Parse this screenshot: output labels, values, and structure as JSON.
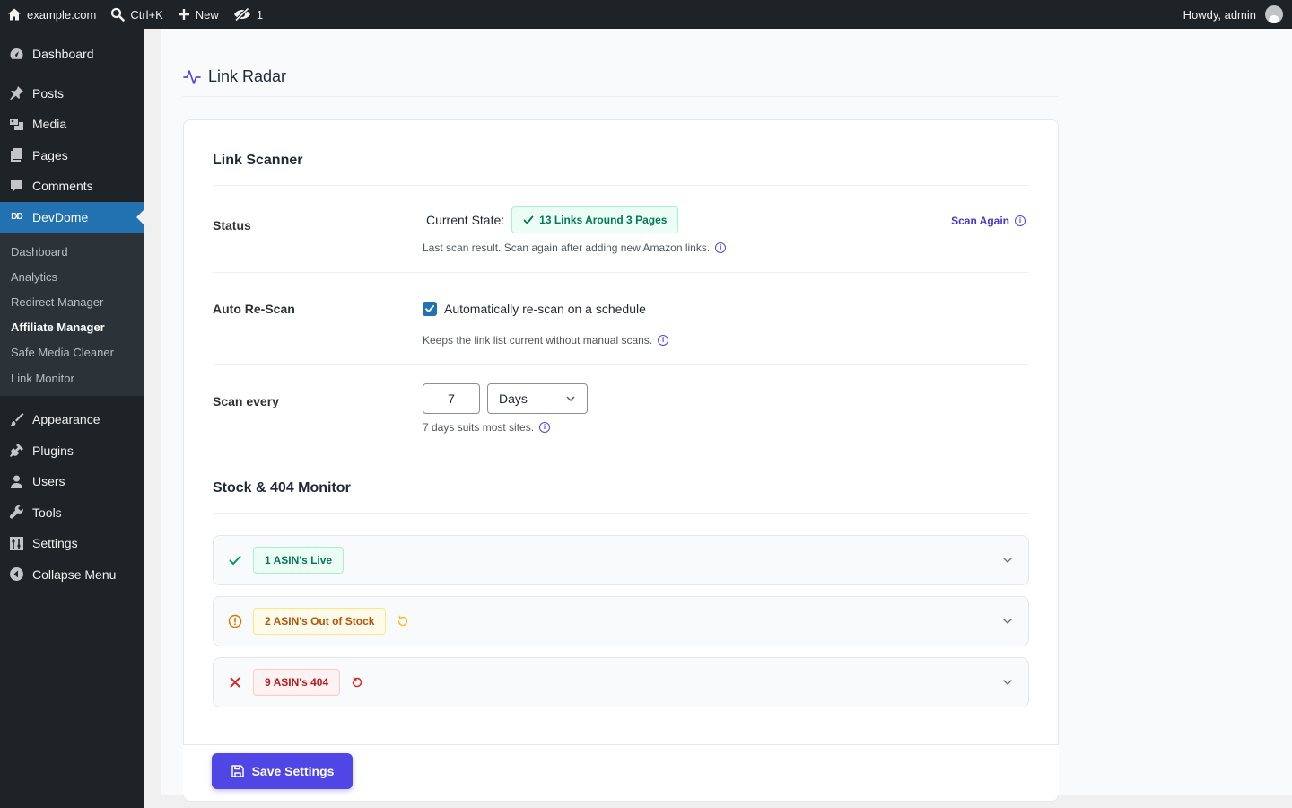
{
  "adminbar": {
    "site": "example.com",
    "search": "Ctrl+K",
    "new": "New",
    "hidden_count": "1",
    "greeting": "Howdy, admin"
  },
  "sidebar": {
    "items_top": [
      {
        "label": "Dashboard",
        "icon": "dashboard-icon"
      },
      {
        "label": "Posts",
        "icon": "pushpin-icon"
      },
      {
        "label": "Media",
        "icon": "media-icon"
      },
      {
        "label": "Pages",
        "icon": "pages-icon"
      },
      {
        "label": "Comments",
        "icon": "comment-icon"
      },
      {
        "label": "DevDome",
        "icon": "devdome-logo-icon",
        "logo_text": "DD"
      }
    ],
    "submenu": [
      {
        "label": "Dashboard"
      },
      {
        "label": "Analytics"
      },
      {
        "label": "Redirect Manager"
      },
      {
        "label": "Affiliate Manager",
        "current": true
      },
      {
        "label": "Safe Media Cleaner"
      },
      {
        "label": "Link Monitor"
      }
    ],
    "items_bottom": [
      {
        "label": "Appearance",
        "icon": "paintbrush-icon"
      },
      {
        "label": "Plugins",
        "icon": "plugin-icon"
      },
      {
        "label": "Users",
        "icon": "user-icon"
      },
      {
        "label": "Tools",
        "icon": "wrench-icon"
      },
      {
        "label": "Settings",
        "icon": "settings-icon"
      },
      {
        "label": "Collapse Menu",
        "icon": "collapse-icon"
      }
    ]
  },
  "page": {
    "title": "Link Radar"
  },
  "scanner": {
    "title": "Link Scanner",
    "status_label": "Status",
    "current_state_label": "Current State:",
    "state_badge": "13 Links Around 3 Pages",
    "status_help": "Last scan result. Scan again after adding new Amazon links.",
    "scan_again": "Scan Again",
    "auto_label": "Auto Re-Scan",
    "auto_checkbox_label": "Automatically re-scan on a schedule",
    "auto_checked": true,
    "auto_help": "Keeps the link list current without manual scans.",
    "every_label": "Scan every",
    "every_value": "7",
    "every_unit": "Days",
    "every_help": "7 days suits most sites."
  },
  "monitor": {
    "title": "Stock & 404 Monitor",
    "rows": [
      {
        "badge": "1 ASIN's Live",
        "status": "live",
        "color": "#047857"
      },
      {
        "badge": "2 ASIN's Out of Stock",
        "status": "out-of-stock",
        "color": "#b45309"
      },
      {
        "badge": "9 ASIN's 404",
        "status": "not-found",
        "color": "#b91c1c"
      }
    ]
  },
  "footer": {
    "save_label": "Save Settings"
  },
  "colors": {
    "accent": "#4f46e5",
    "wp_blue": "#2271b1",
    "admin_dark": "#1d2327"
  }
}
